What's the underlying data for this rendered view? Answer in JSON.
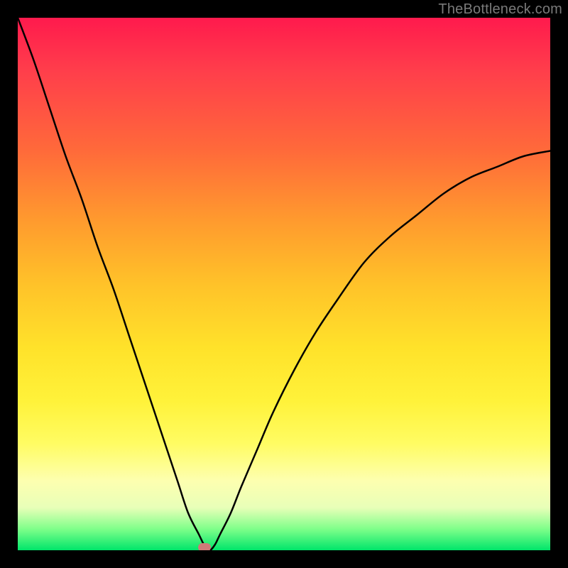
{
  "watermark": "TheBottleneck.com",
  "chart_data": {
    "type": "line",
    "title": "",
    "xlabel": "",
    "ylabel": "",
    "xlim": [
      0,
      100
    ],
    "ylim": [
      0,
      100
    ],
    "grid": false,
    "series": [
      {
        "name": "bottleneck-curve",
        "x": [
          0,
          3,
          6,
          9,
          12,
          15,
          18,
          21,
          24,
          27,
          30,
          32,
          34,
          35,
          36,
          37,
          38,
          40,
          42,
          45,
          48,
          52,
          56,
          60,
          65,
          70,
          75,
          80,
          85,
          90,
          95,
          100
        ],
        "y": [
          100,
          92,
          83,
          74,
          66,
          57,
          49,
          40,
          31,
          22,
          13,
          7,
          3,
          1,
          0,
          1,
          3,
          7,
          12,
          19,
          26,
          34,
          41,
          47,
          54,
          59,
          63,
          67,
          70,
          72,
          74,
          75
        ]
      }
    ],
    "minimum_marker": {
      "x": 35,
      "y": 0
    },
    "background_gradient": {
      "top": "#ff1a4d",
      "bottom": "#00e56a"
    }
  }
}
